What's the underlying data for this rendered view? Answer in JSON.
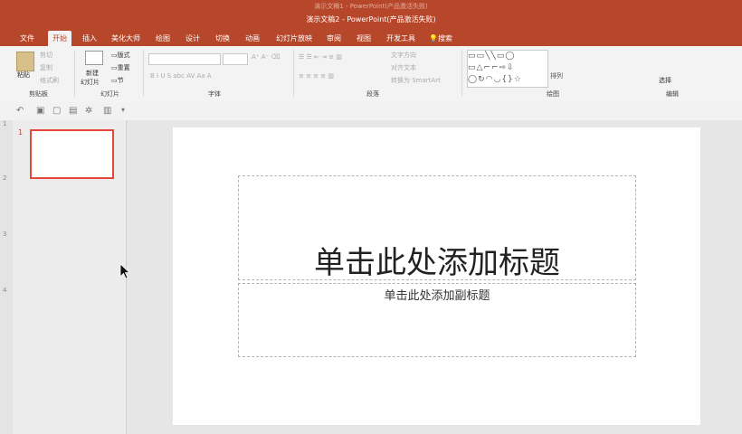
{
  "window": {
    "title_back": "演示文稿1  -  PowerPoint(产品激活失败)",
    "title_front": "演示文稿2  -  PowerPoint(产品激活失败)",
    "accent": "#b7472a"
  },
  "tabs": [
    "文件",
    "开始",
    "插入",
    "美化大师",
    "绘图",
    "设计",
    "切换",
    "动画",
    "幻灯片放映",
    "审阅",
    "视图",
    "开发工具"
  ],
  "active_tab": "开始",
  "search": {
    "label": "搜索",
    "icon": "lightbulb-icon"
  },
  "ribbon": {
    "clipboard": {
      "paste": "粘贴",
      "cut": "剪切",
      "copy": "复制",
      "format_painter": "格式刷",
      "group_label": "剪贴板"
    },
    "slides": {
      "new_slide": "新建",
      "new_slide_line2": "幻灯片",
      "layout": "版式",
      "reset": "重置",
      "section": "节",
      "group_label": "幻灯片"
    },
    "font": {
      "group_label": "字体"
    },
    "paragraph": {
      "text_direction": "文字方向",
      "align_text": "对齐文本",
      "convert_smartart": "转换为 SmartArt",
      "group_label": "段落"
    },
    "drawing": {
      "arrange": "排列",
      "group_label": "绘图"
    },
    "editing": {
      "select": "选择",
      "group_label": "编辑"
    }
  },
  "ruler_marks": [
    "1",
    "2",
    "3",
    "4"
  ],
  "thumbnail": {
    "number": "1"
  },
  "slide": {
    "title_placeholder": "单击此处添加标题",
    "subtitle_placeholder": "单击此处添加副标题"
  }
}
